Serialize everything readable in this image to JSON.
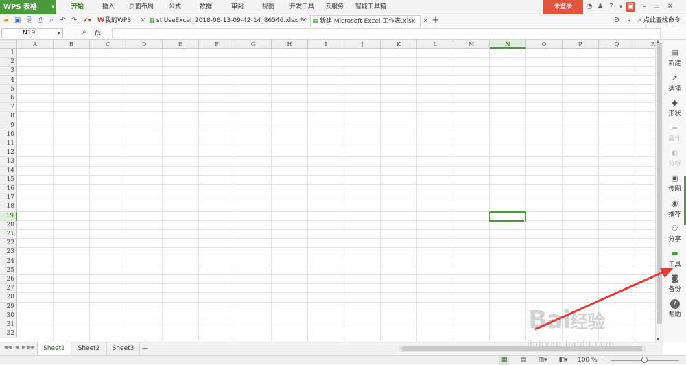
{
  "app": {
    "title": "WPS 表格"
  },
  "menu": {
    "items": [
      "开始",
      "插入",
      "页面布局",
      "公式",
      "数据",
      "审阅",
      "视图",
      "开发工具",
      "云服务",
      "智能工具箱"
    ],
    "active": "开始",
    "login": "未登录"
  },
  "toolbar": {
    "wps_tab": "我的WPS",
    "doc_tabs": [
      {
        "label": "stlUseExcel_2018-08-13-09-42-14_86546.xlsx *"
      },
      {
        "label": "新建 Microsoft Excel 工作表.xlsx",
        "active": true
      }
    ],
    "add_tab": "+",
    "search_cmd": "点此查找命令"
  },
  "formula_bar": {
    "name_box": "N19",
    "fx": "fx",
    "content": ""
  },
  "grid": {
    "columns": [
      "A",
      "B",
      "C",
      "D",
      "E",
      "F",
      "G",
      "H",
      "I",
      "J",
      "K",
      "L",
      "M",
      "N",
      "O",
      "P",
      "Q",
      "R"
    ],
    "rows": [
      "1",
      "2",
      "3",
      "4",
      "5",
      "6",
      "7",
      "8",
      "9",
      "10",
      "11",
      "12",
      "13",
      "14",
      "15",
      "16",
      "17",
      "18",
      "19",
      "20",
      "21",
      "22",
      "23",
      "24",
      "25",
      "26",
      "27",
      "28",
      "29",
      "30",
      "31",
      "32"
    ],
    "selected_cell": "N19",
    "selected_column": "N",
    "selected_row": "19"
  },
  "right_panel": {
    "items": [
      {
        "label": "新建",
        "icon": "new-doc-icon"
      },
      {
        "label": "选择",
        "icon": "select-cursor-icon"
      },
      {
        "label": "形状",
        "icon": "shape-icon"
      },
      {
        "label": "属性",
        "icon": "properties-icon",
        "disabled": true
      },
      {
        "label": "分析",
        "icon": "analysis-icon",
        "disabled": true
      },
      {
        "label": "传图",
        "icon": "upload-image-icon"
      },
      {
        "label": "推荐",
        "icon": "recommend-icon"
      },
      {
        "label": "分享",
        "icon": "share-icon"
      },
      {
        "label": "工具",
        "icon": "toolbox-icon"
      },
      {
        "label": "备份",
        "icon": "backup-icon"
      },
      {
        "label": "帮助",
        "icon": "help-icon"
      }
    ]
  },
  "sheets": {
    "tabs": [
      "Sheet1",
      "Sheet2",
      "Sheet3"
    ],
    "active": "Sheet1",
    "add": "+"
  },
  "status": {
    "zoom": "100 %",
    "zoom_minus": "−",
    "zoom_level": 0.5
  },
  "watermark": {
    "logo": "Bai经验",
    "url": "jingyan.baidu.com"
  },
  "colors": {
    "accent": "#4a9a3c",
    "login_bg": "#e1553f",
    "arrow": "#e53935"
  }
}
